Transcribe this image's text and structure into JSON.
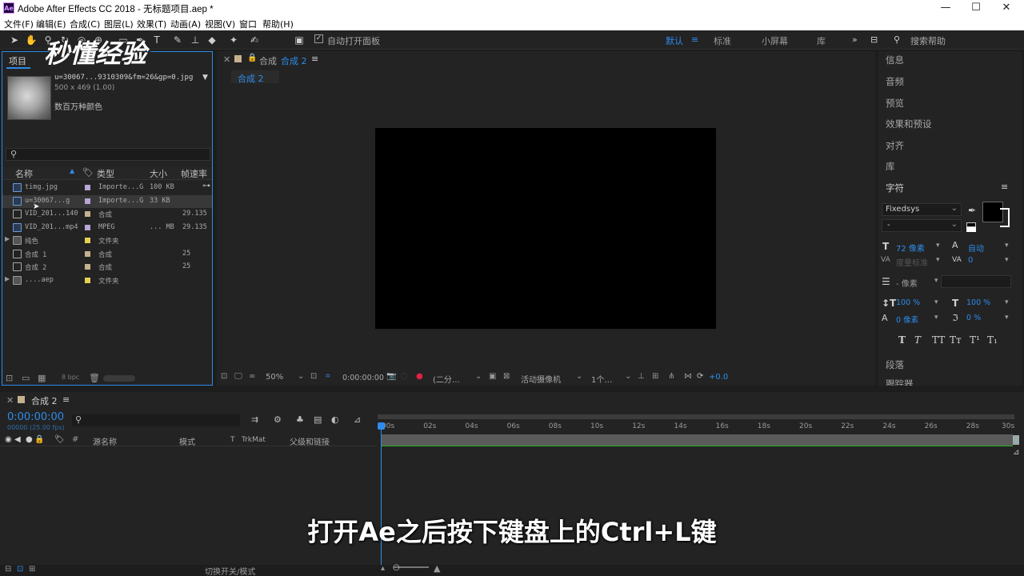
{
  "window": {
    "app_icon": "Ae",
    "title": "Adobe After Effects CC 2018 - 无标题项目.aep *",
    "minimize": "—",
    "maximize": "☐",
    "close": "✕"
  },
  "menu": [
    "文件(F)",
    "编辑(E)",
    "合成(C)",
    "图层(L)",
    "效果(T)",
    "动画(A)",
    "视图(V)",
    "窗口",
    "帮助(H)"
  ],
  "toolbar": {
    "auto_open_label": "自动打开面板",
    "workspaces": [
      "默认",
      "标准",
      "小屏幕",
      "库"
    ],
    "search_placeholder": "搜索帮助"
  },
  "project": {
    "tab": "项目",
    "selected_name": "u=30067...9310309&fm=26&gp=0.jpg",
    "selected_dims": "500 x 469 (1.00)",
    "selected_colors": "数百万种颜色",
    "columns": [
      "名称",
      "类型",
      "大小",
      "帧速率"
    ],
    "items": [
      {
        "name": "timg.jpg",
        "type": "Importe...G",
        "size": "100 KB",
        "fps": "",
        "swatch": "#b7a6d6"
      },
      {
        "name": "u=30067...g",
        "type": "Importe...G",
        "size": "33 KB",
        "fps": "",
        "swatch": "#b7a6d6"
      },
      {
        "name": "VID_201...140",
        "type": "合成",
        "size": "",
        "fps": "29.135",
        "swatch": "#c5b08f"
      },
      {
        "name": "VID_201...mp4",
        "type": "MPEG",
        "size": "... MB",
        "fps": "29.135",
        "swatch": "#b7a6d6"
      },
      {
        "name": "纯色",
        "type": "文件夹",
        "size": "",
        "fps": "",
        "swatch": "#e5cf55"
      },
      {
        "name": "合成 1",
        "type": "合成",
        "size": "",
        "fps": "25",
        "swatch": "#c5b08f"
      },
      {
        "name": "合成 2",
        "type": "合成",
        "size": "",
        "fps": "25",
        "swatch": "#c5b08f"
      },
      {
        "name": "....aep",
        "type": "文件夹",
        "size": "",
        "fps": "",
        "swatch": "#e5cf55"
      }
    ],
    "bpc": "8 bpc"
  },
  "viewer": {
    "tab_prefix": "合成",
    "tab_name": "合成 2",
    "breadcrumb": "合成 2",
    "zoom": "50%",
    "timecode": "0:00:00:00",
    "resolution": "(二分…",
    "camera": "活动摄像机",
    "views": "1个…",
    "exposure": "+0.0"
  },
  "right_panel": {
    "items": [
      "信息",
      "音频",
      "预览",
      "效果和预设",
      "对齐",
      "库"
    ],
    "character": {
      "title": "字符",
      "font": "Fixedsys",
      "style": "-",
      "size": "72 像素",
      "leading": "自动",
      "kerning": "度量标准",
      "tracking": "0",
      "stroke": "- 像素",
      "vscale": "100 %",
      "hscale": "100 %",
      "baseline": "0 像素",
      "tsume": "0 %",
      "styles": [
        "T",
        "T",
        "TT",
        "Tт",
        "T¹",
        "T₁"
      ]
    },
    "paragraph": "段落",
    "tracker": "跟踪器"
  },
  "timeline": {
    "tab": "合成 2",
    "timecode": "0:00:00:00",
    "subcode": "00000 (25.00 fps)",
    "columns": [
      "源名称",
      "模式",
      "T",
      "TrkMat",
      "父级和链接"
    ],
    "ticks": [
      "00s",
      "02s",
      "04s",
      "06s",
      "08s",
      "10s",
      "12s",
      "14s",
      "16s",
      "18s",
      "20s",
      "22s",
      "24s",
      "26s",
      "28s",
      "30s"
    ],
    "toggle_label": "切换开关/模式"
  },
  "subtitle": "打开Ae之后按下键盘上的Ctrl+L键",
  "watermark": "秒懂经验"
}
